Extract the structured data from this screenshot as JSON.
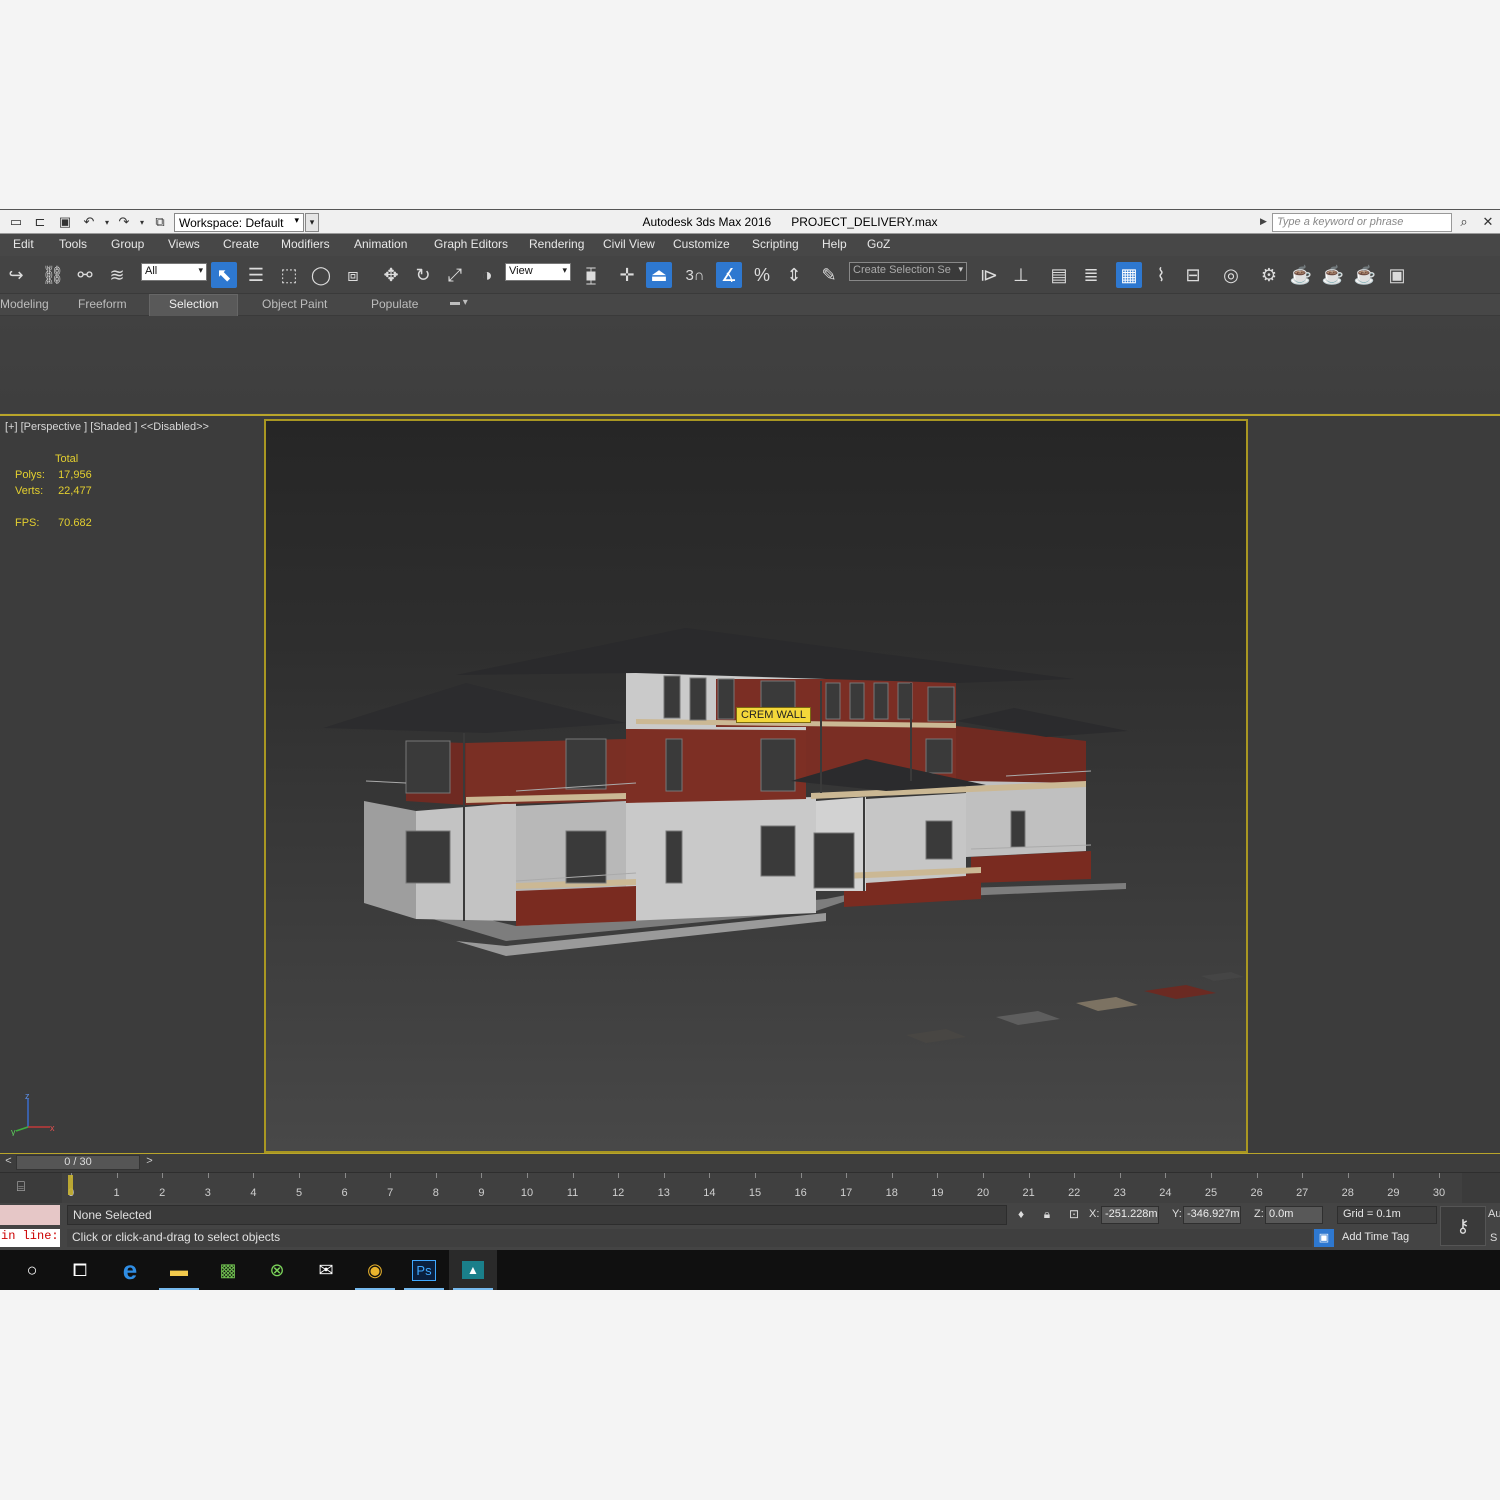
{
  "titlebar": {
    "workspace": "Workspace: Default",
    "app_name": "Autodesk 3ds Max 2016",
    "file_name": "PROJECT_DELIVERY.max",
    "search_placeholder": "Type a keyword or phrase"
  },
  "menu": [
    "Edit",
    "Tools",
    "Group",
    "Views",
    "Create",
    "Modifiers",
    "Animation",
    "Graph Editors",
    "Rendering",
    "Civil View",
    "Customize",
    "Scripting",
    "Help",
    "GoZ"
  ],
  "toolbar": {
    "filter": "All",
    "ref_coord": "View",
    "snap_label": "3",
    "selection_set": "Create Selection Se",
    "active_tools": [
      "select-object",
      "select-move-manipulate",
      "angle-snap",
      "selection-set-highlight"
    ]
  },
  "ribbon": {
    "tabs": [
      "Modeling",
      "Freeform",
      "Selection",
      "Object Paint",
      "Populate"
    ],
    "active_tab": "Selection"
  },
  "viewport": {
    "label": "[+] [Perspective ] [Shaded ]  <<Disabled>>",
    "stats": {
      "header": "Total",
      "polys_label": "Polys:",
      "polys": "17,956",
      "verts_label": "Verts:",
      "verts": "22,477",
      "fps_label": "FPS:",
      "fps": "70.682"
    },
    "tooltip": "CREM WALL",
    "axis": {
      "z": "z",
      "y": "y",
      "x": "x"
    },
    "colors": {
      "brick": "#7a2b20",
      "wall": "#c9c9c9",
      "roof": "#2b2b2d",
      "trim": "#cbb894",
      "frame": "#a99722"
    }
  },
  "time_slider": {
    "prev": "<",
    "position": "0 / 30",
    "next": ">"
  },
  "track_ticks": [
    "0",
    "1",
    "2",
    "3",
    "4",
    "5",
    "6",
    "7",
    "8",
    "9",
    "10",
    "11",
    "12",
    "13",
    "14",
    "15",
    "16",
    "17",
    "18",
    "19",
    "20",
    "21",
    "22",
    "23",
    "24",
    "25",
    "26",
    "27",
    "28",
    "29",
    "30"
  ],
  "status": {
    "maxscript": "in line:",
    "selection": "None Selected",
    "prompt": "Click or click-and-drag to select objects",
    "x_label": "X:",
    "x": "-251.228m",
    "y_label": "Y:",
    "y": "-346.927m",
    "z_label": "Z:",
    "z": "0.0m",
    "grid": "Grid = 0.1m",
    "time_tag": "Add Time Tag",
    "auto_fragment": "Au",
    "set_fragment": "S"
  },
  "taskbar": [
    "cortana-icon",
    "task-view-icon",
    "edge-icon",
    "file-explorer-icon",
    "photos-icon",
    "xbox-icon",
    "mail-icon",
    "chrome-icon",
    "photoshop-icon",
    "3dsmax-icon"
  ]
}
